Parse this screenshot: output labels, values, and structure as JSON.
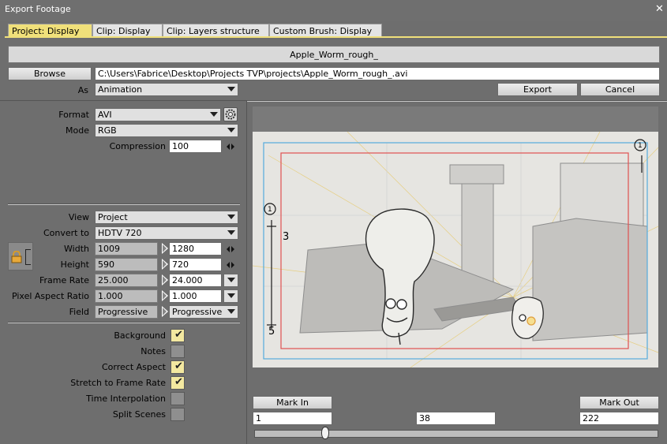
{
  "window": {
    "title": "Export Footage",
    "close_glyph": "✕"
  },
  "tabs": [
    {
      "label": "Project: Display",
      "active": true
    },
    {
      "label": "Clip: Display",
      "active": false
    },
    {
      "label": "Clip: Layers structure",
      "active": false
    },
    {
      "label": "Custom Brush: Display",
      "active": false
    }
  ],
  "top": {
    "project_name": "Apple_Worm_rough_",
    "browse_label": "Browse",
    "path": "C:\\Users\\Fabrice\\Desktop\\Projects TVP\\projects\\Apple_Worm_rough_.avi",
    "as_label": "As",
    "as_value": "Animation",
    "export_label": "Export",
    "cancel_label": "Cancel"
  },
  "format": {
    "format_label": "Format",
    "format_value": "AVI",
    "mode_label": "Mode",
    "mode_value": "RGB",
    "compression_label": "Compression",
    "compression_value": "100"
  },
  "resize": {
    "view_label": "View",
    "view_value": "Project",
    "convert_label": "Convert to",
    "convert_value": "HDTV 720",
    "width_label": "Width",
    "width_src": "1009",
    "width_dst": "1280",
    "height_label": "Height",
    "height_src": "590",
    "height_dst": "720",
    "framerate_label": "Frame Rate",
    "framerate_src": "25.000",
    "framerate_dst": "24.000",
    "par_label": "Pixel Aspect Ratio",
    "par_src": "1.000",
    "par_dst": "1.000",
    "field_label": "Field",
    "field_src": "Progressive",
    "field_dst": "Progressive"
  },
  "options": [
    {
      "label": "Background",
      "checked": true
    },
    {
      "label": "Notes",
      "checked": false
    },
    {
      "label": "Correct Aspect",
      "checked": true
    },
    {
      "label": "Stretch to Frame Rate",
      "checked": true
    },
    {
      "label": "Time Interpolation",
      "checked": false
    },
    {
      "label": "Split Scenes",
      "checked": false
    }
  ],
  "timeline": {
    "mark_in_label": "Mark In",
    "mark_out_label": "Mark Out",
    "in_value": "1",
    "current_value": "38",
    "out_value": "222",
    "slider_position": 0.17
  },
  "sketch": {
    "circle_marker_left": "1",
    "circle_marker_right": "1",
    "left_number": "3",
    "left_bottom_number": "5"
  },
  "colors": {
    "tab_active": "#f0e07a",
    "check_on": "#f3e8a0",
    "safe_red": "#e05050",
    "safe_blue": "#55aadd"
  }
}
